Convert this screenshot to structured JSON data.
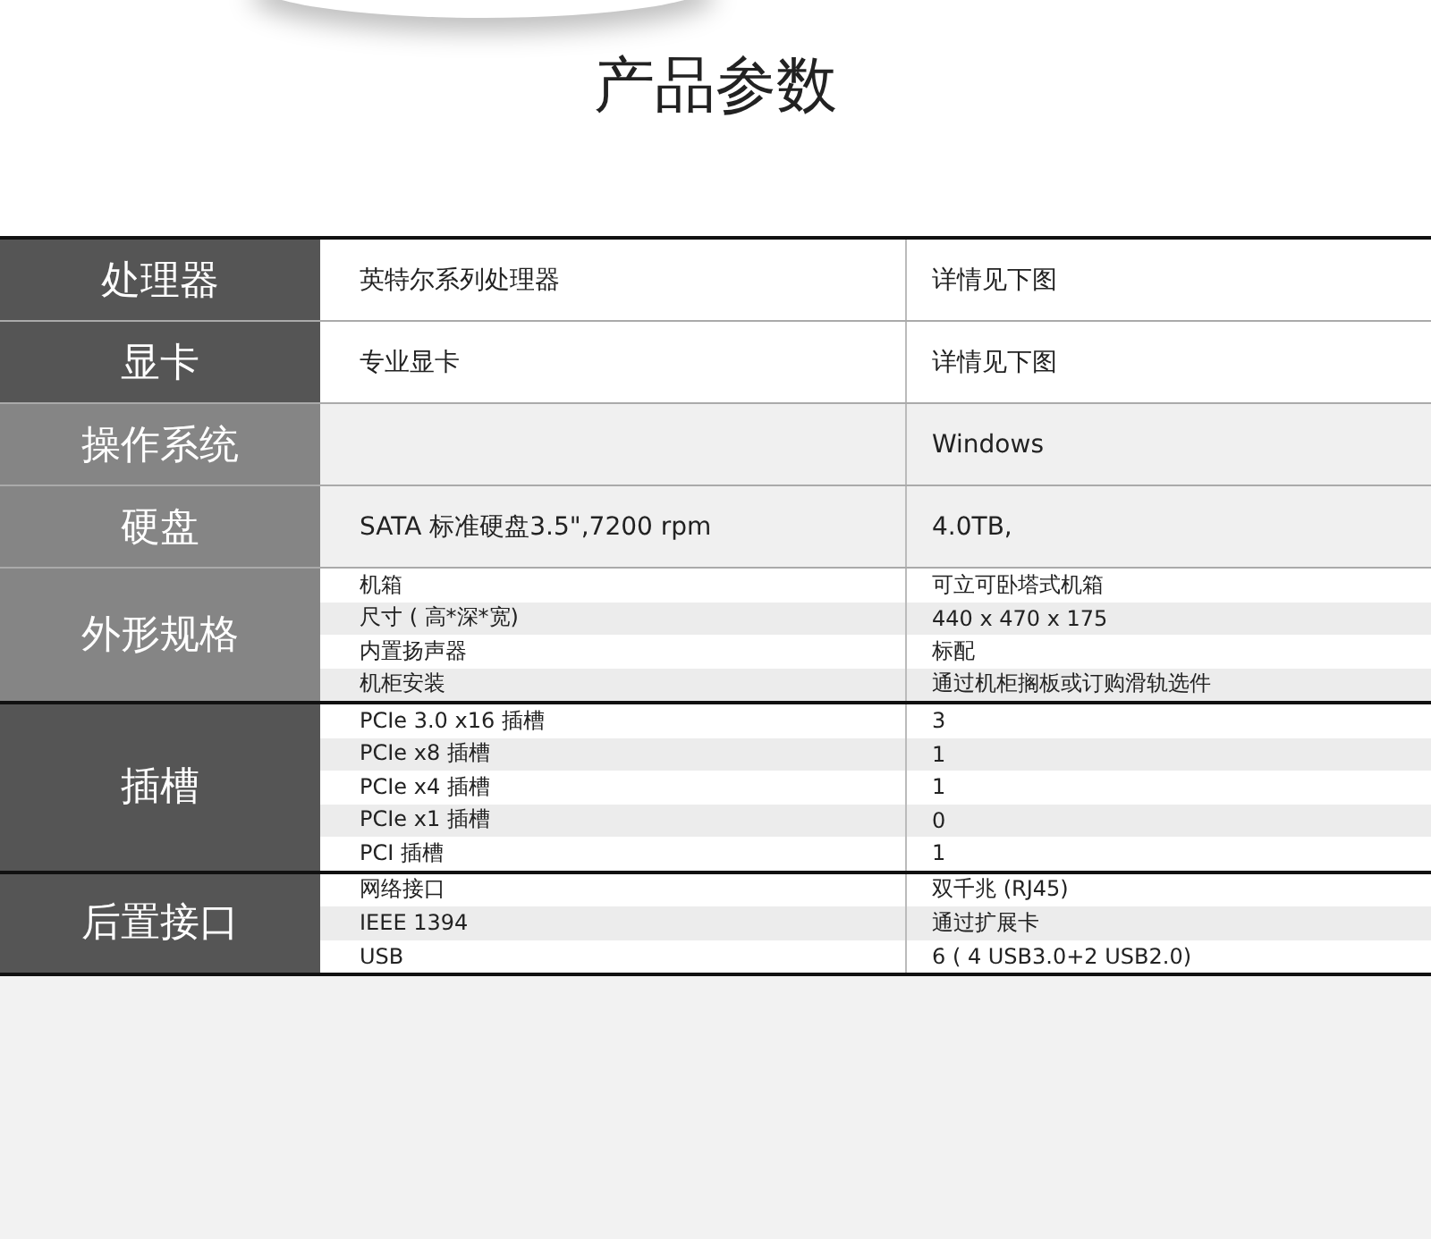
{
  "title": "产品参数",
  "sections": [
    {
      "label": "处理器",
      "kind": "dark",
      "rows": [
        {
          "spec": "英特尔系列处理器",
          "value": "详情见下图"
        }
      ]
    },
    {
      "label": "显卡",
      "kind": "dark",
      "rows": [
        {
          "spec": "专业显卡",
          "value": "详情见下图"
        }
      ]
    },
    {
      "label": "操作系统",
      "kind": "light",
      "rows": [
        {
          "value": "Windows"
        }
      ]
    },
    {
      "label": "硬盘",
      "kind": "light",
      "rows": [
        {
          "spec": "SATA 标准硬盘3.5\",7200 rpm",
          "value": "4.0TB,"
        }
      ]
    },
    {
      "label": "外形规格",
      "kind": "light",
      "rows": [
        {
          "spec": "机箱",
          "value": "可立可卧塔式机箱"
        },
        {
          "spec": "尺寸 ( 高*深*宽)",
          "value": "440 x 470 x 175"
        },
        {
          "spec": "内置扬声器",
          "value": "标配"
        },
        {
          "spec": "机柜安装",
          "value": "通过机柜搁板或订购滑轨选件"
        }
      ]
    },
    {
      "label": "插槽",
      "kind": "dark",
      "rows": [
        {
          "spec": "PCIe 3.0 x16 插槽",
          "value": "3"
        },
        {
          "spec": "PCIe x8 插槽",
          "value": "1"
        },
        {
          "spec": "PCIe x4 插槽",
          "value": "1"
        },
        {
          "spec": "PCIe x1 插槽",
          "value": "0"
        },
        {
          "spec": "PCI 插槽",
          "value": "1"
        }
      ]
    },
    {
      "label": "后置接口",
      "kind": "dark",
      "rows": [
        {
          "spec": "网络接口",
          "value": "双千兆 (RJ45)"
        },
        {
          "spec": "IEEE 1394",
          "value": "通过扩展卡"
        },
        {
          "spec": "USB",
          "value": "6 ( 4 USB3.0+2 USB2.0)"
        }
      ]
    }
  ]
}
